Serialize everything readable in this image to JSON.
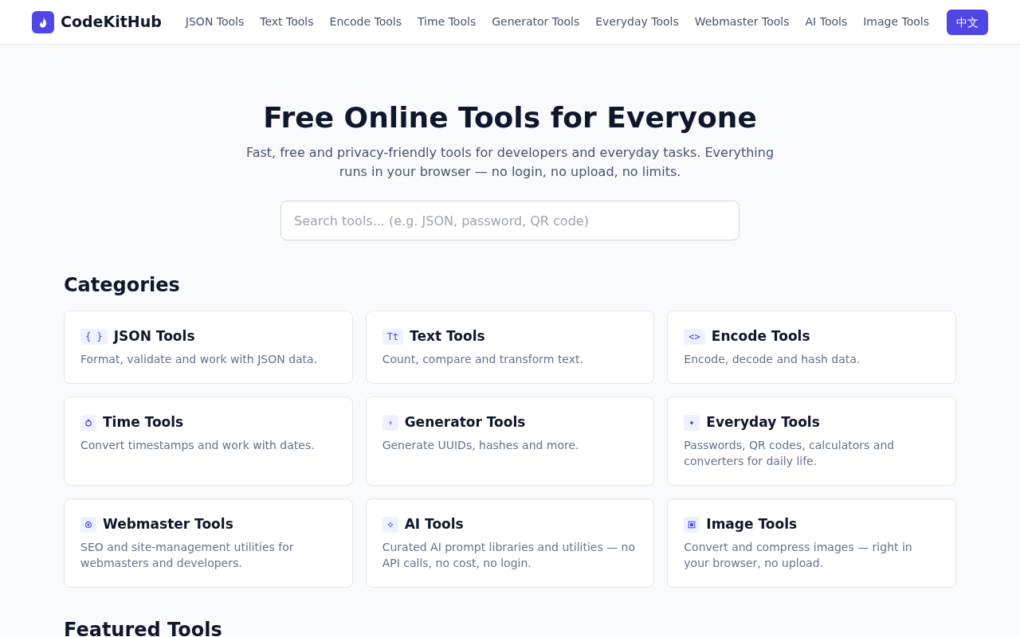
{
  "header": {
    "brand": "CodeKitHub",
    "nav": [
      "JSON Tools",
      "Text Tools",
      "Encode Tools",
      "Time Tools",
      "Generator Tools",
      "Everyday Tools",
      "Webmaster Tools",
      "AI Tools",
      "Image Tools"
    ],
    "language_button": "中文"
  },
  "hero": {
    "title": "Free Online Tools for Everyone",
    "subtitle": "Fast, free and privacy-friendly tools for developers and everyday tasks. Everything runs in your browser — no login, no upload, no limits.",
    "search": {
      "placeholder": "Search tools... (e.g. JSON, password, QR code)"
    }
  },
  "categories": {
    "heading": "Categories",
    "items": [
      {
        "kind": "braces",
        "icon": "{ }",
        "title": "JSON Tools",
        "description": "Format, validate and work with JSON data."
      },
      {
        "kind": "letters",
        "icon": "Tt",
        "title": "Text Tools",
        "description": "Count, compare and transform text."
      },
      {
        "kind": "angle-brackets",
        "icon": "<>",
        "title": "Encode Tools",
        "description": "Encode, decode and hash data."
      },
      {
        "kind": "stopwatch",
        "title": "Time Tools",
        "description": "Convert timestamps and work with dates."
      },
      {
        "kind": "lightning",
        "title": "Generator Tools",
        "description": "Generate UUIDs, hashes and more."
      },
      {
        "kind": "sparkle",
        "title": "Everyday Tools",
        "description": "Passwords, QR codes, calculators and converters for daily life."
      },
      {
        "kind": "target",
        "title": "Webmaster Tools",
        "description": "SEO and site-management utilities for webmasters and developers."
      },
      {
        "kind": "sparkle-outline",
        "title": "AI Tools",
        "description": "Curated AI prompt libraries and utilities — no API calls, no cost, no login."
      },
      {
        "kind": "square",
        "title": "Image Tools",
        "description": "Convert and compress images — right in your browser, no upload."
      }
    ]
  },
  "featured": {
    "heading": "Featured Tools"
  }
}
